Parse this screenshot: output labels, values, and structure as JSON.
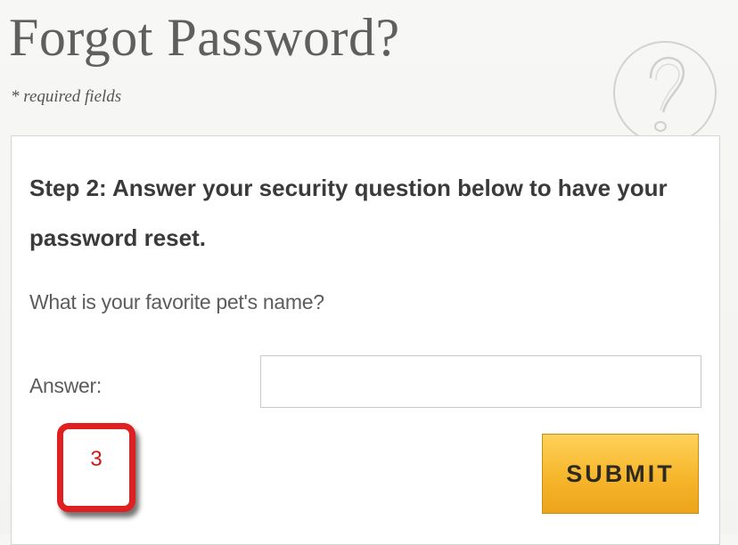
{
  "page": {
    "title": "Forgot Password?",
    "required_note": "* required fields",
    "help_icon": "question-mark-icon"
  },
  "form": {
    "step_heading": "Step 2: Answer your security question below to have your password reset.",
    "security_question": "What is your favorite pet's name?",
    "answer_label": "Answer:",
    "answer_value": "",
    "submit_label": "SUBMIT"
  },
  "annotation": {
    "step_number": "3"
  },
  "colors": {
    "submit_button": "#f6b62b",
    "annotation_border": "#e02020",
    "title_text": "#5f5f5f"
  }
}
